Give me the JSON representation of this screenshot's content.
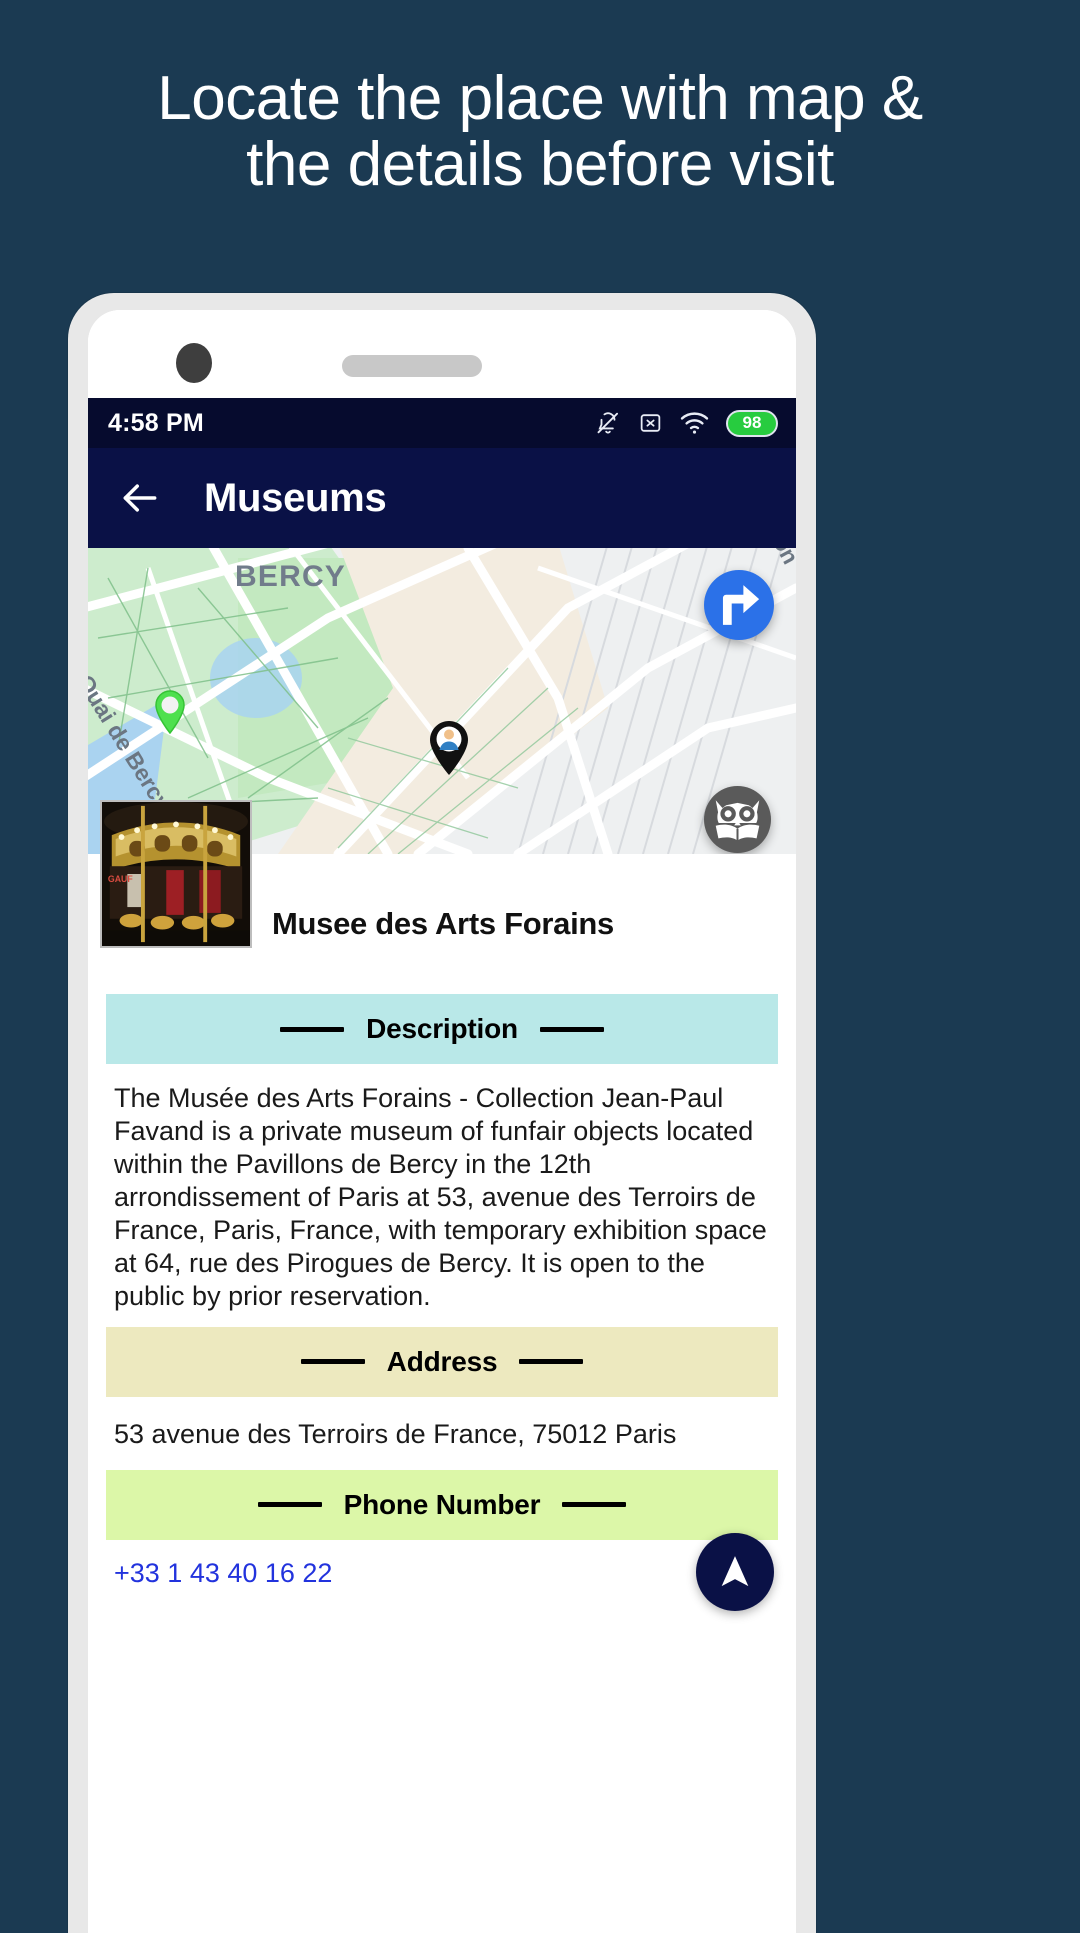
{
  "promo": {
    "headline_line1": "Locate the place with map &",
    "headline_line2": "the details before visit",
    "background_color": "#1b3a52"
  },
  "status_bar": {
    "time": "4:58 PM",
    "battery_percent": "98",
    "battery_color": "#27cc3f",
    "icons": [
      "bell-off-icon",
      "sim-card-off-icon",
      "wifi-icon",
      "battery-icon"
    ]
  },
  "app_bar": {
    "title": "Museums",
    "back_icon": "arrow-left-icon",
    "background_color": "#0a1146"
  },
  "map": {
    "area_label": "BERCY",
    "street_label_right": "Rue de Charenton",
    "street_label_left": "Quai de Bercy",
    "markers": [
      "green-location-pin",
      "person-location-pin"
    ],
    "buttons": [
      {
        "name": "directions-fab",
        "icon": "turn-right-arrow-icon",
        "color": "#2b71e8"
      },
      {
        "name": "wiki-fab",
        "icon": "owl-book-icon",
        "color": "#5a5a5a"
      },
      {
        "name": "share-fab",
        "icon": "share-nodes-icon",
        "color": "#265584"
      }
    ]
  },
  "place": {
    "name": "Musee des Arts Forains",
    "thumbnail_alt": "carousel-photo"
  },
  "sections": {
    "description": {
      "title": "Description",
      "header_color": "#b9e8e8",
      "text": "The Musée des Arts Forains - Collection Jean-Paul Favand is a private museum of funfair objects located within the Pavillons de Bercy in the 12th arrondissement of Paris at 53, avenue des Terroirs de France, Paris, France, with temporary exhibition space at 64, rue des Pirogues de Bercy. It is open to the public by prior reservation."
    },
    "address": {
      "title": "Address",
      "header_color": "#ede9bf",
      "text": "53 avenue des Terroirs de France, 75012 Paris"
    },
    "phone": {
      "title": "Phone Number",
      "header_color": "#dcf7a8",
      "text": "+33 1 43 40 16 22"
    }
  },
  "bottom_fab": {
    "name": "navigate-fab",
    "icon": "navigation-arrow-icon",
    "color": "#0a1146"
  }
}
